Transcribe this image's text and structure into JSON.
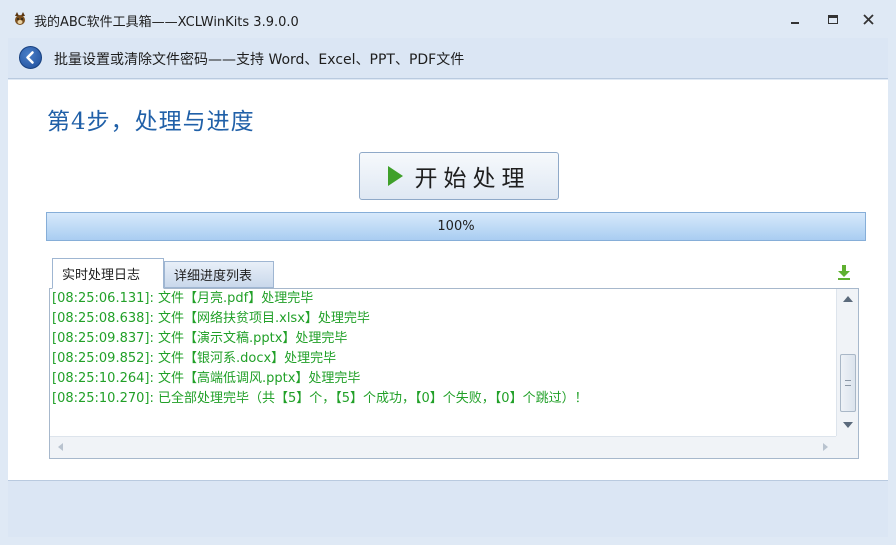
{
  "window": {
    "title": "我的ABC软件工具箱——XCLWinKits  3.9.0.0",
    "icon": "fox-app-icon"
  },
  "subheader": {
    "back_icon": "back-arrow-icon",
    "text": "批量设置或清除文件密码——支持 Word、Excel、PPT、PDF文件"
  },
  "main": {
    "step_title": "第4步，处理与进度",
    "start_button": {
      "icon": "play-icon",
      "label": "开始处理"
    },
    "progress": {
      "value": 100,
      "text": "100%"
    }
  },
  "tabs": [
    {
      "label": "实时处理日志",
      "active": true
    },
    {
      "label": "详细进度列表",
      "active": false
    }
  ],
  "log": {
    "color": "#21a028",
    "lines": [
      "[08:25:06.131]: 文件【月亮.pdf】处理完毕",
      "[08:25:08.638]: 文件【网络扶贫项目.xlsx】处理完毕",
      "[08:25:09.837]: 文件【演示文稿.pptx】处理完毕",
      "[08:25:09.852]: 文件【银河系.docx】处理完毕",
      "[08:25:10.264]: 文件【高端低调风.pptx】处理完毕",
      "[08:25:10.270]: 已全部处理完毕（共【5】个，【5】个成功，【0】个失败，【0】个跳过）！"
    ]
  },
  "colors": {
    "accent": "#2060a8",
    "progress": "#a9cdf1",
    "frame": "#dfe9f5"
  }
}
